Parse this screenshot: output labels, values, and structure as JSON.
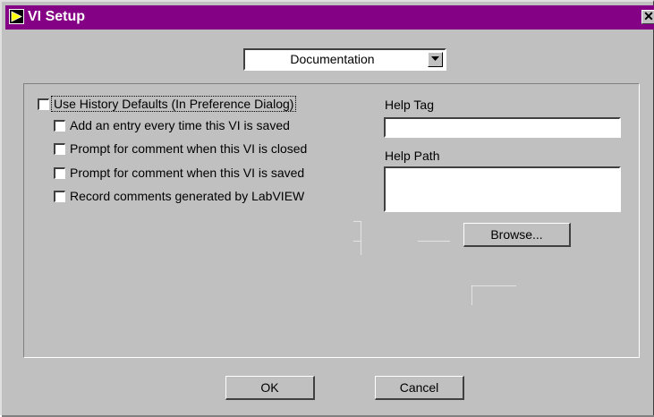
{
  "window": {
    "title": "VI Setup",
    "icon": "labview-arrow-icon",
    "close_glyph": "✕"
  },
  "category_select": {
    "value": "Documentation",
    "arrow_icon": "chevron-down-icon"
  },
  "history": {
    "use_defaults_label": "Use History Defaults (In Preference Dialog)",
    "use_defaults_checked": false,
    "options": [
      {
        "label": "Add an entry every time this VI is saved",
        "checked": false
      },
      {
        "label": "Prompt for comment when this VI is closed",
        "checked": false
      },
      {
        "label": "Prompt for comment when this VI is saved",
        "checked": false
      },
      {
        "label": "Record comments generated by LabVIEW",
        "checked": false
      }
    ]
  },
  "help": {
    "tag_label": "Help Tag",
    "tag_value": "",
    "path_label": "Help Path",
    "path_value": "",
    "browse_label": "Browse..."
  },
  "footer": {
    "ok_label": "OK",
    "cancel_label": "Cancel"
  },
  "colors": {
    "titlebar": "#840084",
    "face": "#c0c0c0"
  }
}
